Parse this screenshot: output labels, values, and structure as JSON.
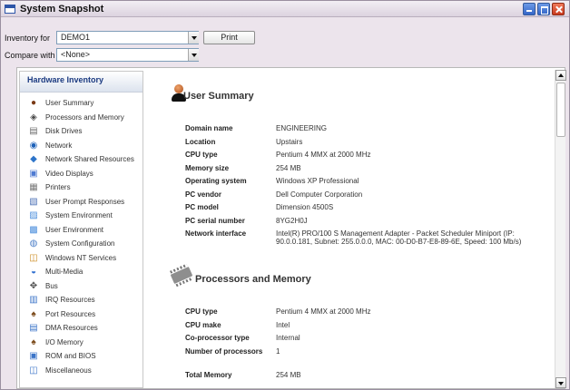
{
  "window": {
    "title": "System Snapshot"
  },
  "toolbar": {
    "inventory_label": "Inventory for",
    "inventory_value": "DEMO1",
    "compare_label": "Compare with",
    "compare_value": "<None>",
    "print_label": "Print"
  },
  "sidebar": {
    "title": "Hardware Inventory",
    "items": [
      {
        "label": "User Summary",
        "icon": "user-icon"
      },
      {
        "label": "Processors and Memory",
        "icon": "chip-icon"
      },
      {
        "label": "Disk Drives",
        "icon": "disk-icon"
      },
      {
        "label": "Network",
        "icon": "globe-icon"
      },
      {
        "label": "Network Shared Resources",
        "icon": "network-share-icon"
      },
      {
        "label": "Video Displays",
        "icon": "monitor-icon"
      },
      {
        "label": "Printers",
        "icon": "printer-icon"
      },
      {
        "label": "User Prompt Responses",
        "icon": "prompt-icon"
      },
      {
        "label": "System Environment",
        "icon": "environment-icon"
      },
      {
        "label": "User Environment",
        "icon": "user-env-icon"
      },
      {
        "label": "System Configuration",
        "icon": "config-icon"
      },
      {
        "label": "Windows NT Services",
        "icon": "services-icon"
      },
      {
        "label": "Multi-Media",
        "icon": "multimedia-icon"
      },
      {
        "label": "Bus",
        "icon": "bus-icon"
      },
      {
        "label": "IRQ Resources",
        "icon": "irq-icon"
      },
      {
        "label": "Port Resources",
        "icon": "port-icon"
      },
      {
        "label": "DMA Resources",
        "icon": "dma-icon"
      },
      {
        "label": "I/O Memory",
        "icon": "io-memory-icon"
      },
      {
        "label": "ROM and BIOS",
        "icon": "rom-icon"
      },
      {
        "label": "Miscellaneous",
        "icon": "misc-icon"
      }
    ]
  },
  "sections": {
    "user_summary": {
      "title": "User Summary",
      "rows": [
        {
          "key": "Domain name",
          "value": "ENGINEERING"
        },
        {
          "key": "Location",
          "value": "Upstairs"
        },
        {
          "key": "CPU type",
          "value": "Pentium 4 MMX at 2000 MHz"
        },
        {
          "key": "Memory size",
          "value": "254 MB"
        },
        {
          "key": "Operating system",
          "value": "Windows XP Professional"
        },
        {
          "key": "PC vendor",
          "value": "Dell Computer Corporation"
        },
        {
          "key": "PC model",
          "value": "Dimension 4500S"
        },
        {
          "key": "PC serial number",
          "value": "8YG2H0J"
        },
        {
          "key": "Network interface",
          "value": "Intel(R) PRO/100 S Management Adapter - Packet Scheduler Miniport (IP: 90.0.0.181, Subnet: 255.0.0.0, MAC: 00-D0-B7-E8-89-6E, Speed: 100 Mb/s)"
        }
      ]
    },
    "processors": {
      "title": "Processors and Memory",
      "rows": [
        {
          "key": "CPU type",
          "value": "Pentium 4 MMX at 2000 MHz"
        },
        {
          "key": "CPU make",
          "value": "Intel"
        },
        {
          "key": "Co-processor type",
          "value": "Internal"
        },
        {
          "key": "Number of processors",
          "value": "1"
        },
        {
          "key": "Total Memory",
          "value": "254 MB"
        }
      ]
    }
  }
}
